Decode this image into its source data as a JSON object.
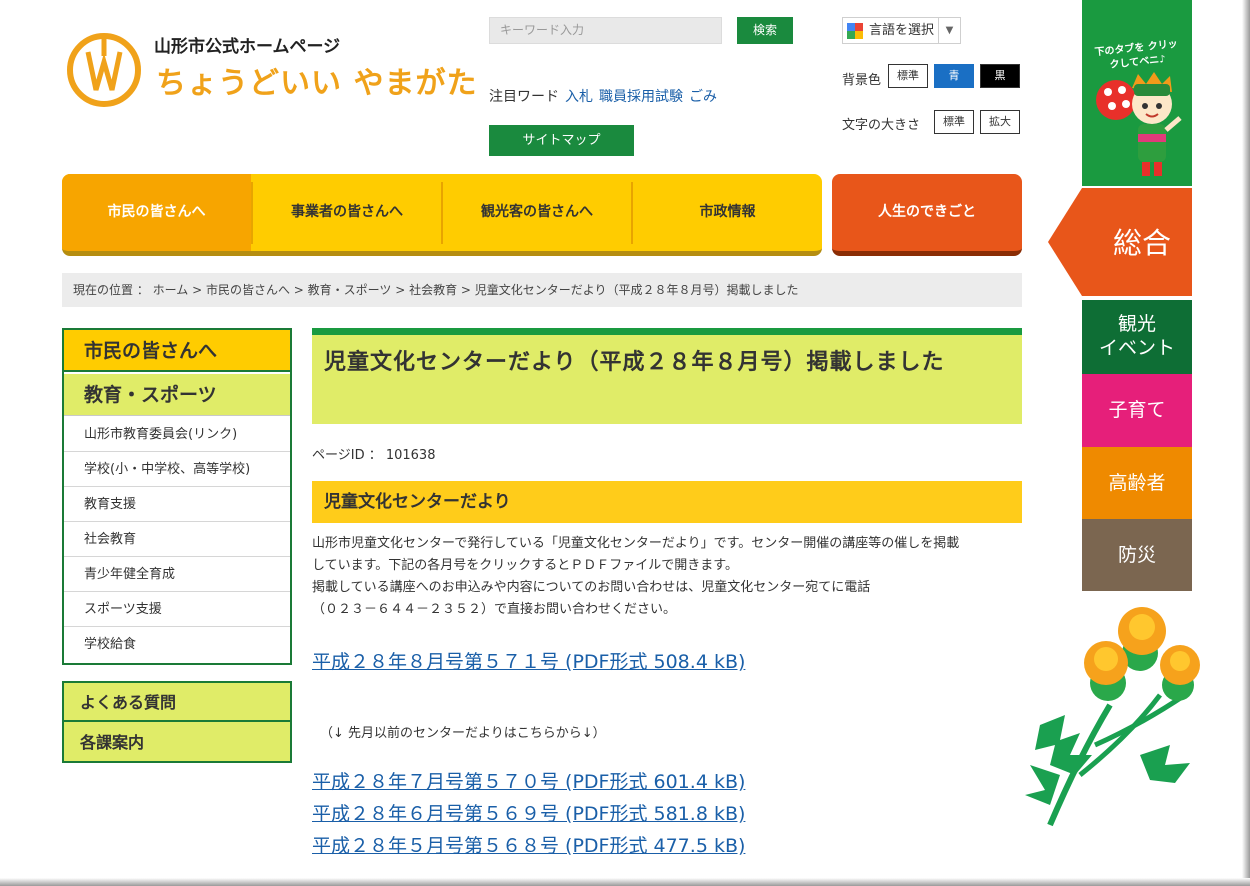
{
  "header": {
    "site_name": "山形市公式ホームページ",
    "site_catch": "ちょうどいい やまがた",
    "search_placeholder": "キーワード入力",
    "search_button": "検索",
    "attention_label": "注目ワード",
    "attention_words": [
      "入札",
      "職員採用試験",
      "ごみ"
    ],
    "sitemap_button": "サイトマップ",
    "translate_label": "言語を選択",
    "translate_arrow": "▼",
    "bg_color_label": "背景色",
    "bg_buttons": [
      "標準",
      "青",
      "黒"
    ],
    "font_size_label": "文字の大きさ",
    "font_buttons": [
      "標準",
      "拡大"
    ]
  },
  "gnav": {
    "items": [
      "市民の皆さんへ",
      "事業者の皆さんへ",
      "観光客の皆さんへ",
      "市政情報"
    ],
    "life_button": "人生のできごと"
  },
  "breadcrumb": "現在の位置 ： ホーム > 市民の皆さんへ > 教育・スポーツ > 社会教育 > 児童文化センターだより（平成２８年８月号）掲載しました",
  "sidebar": {
    "head1": "市民の皆さんへ",
    "head2": "教育・スポーツ",
    "items": [
      "山形市教育委員会(リンク)",
      "学校(小・中学校、高等学校)",
      "教育支援",
      "社会教育",
      "青少年健全育成",
      "スポーツ支援",
      "学校給食"
    ],
    "links": [
      "よくある質問",
      "各課案内"
    ]
  },
  "main": {
    "title": "児童文化センターだより（平成２８年８月号）掲載しました",
    "page_id": "ページID ： 101638",
    "section_title": "児童文化センターだより",
    "body_line1": "山形市児童文化センターで発行している「児童文化センターだより」です。センター開催の講座等の催しを掲載",
    "body_line2": "しています。下記の各月号をクリックするとＰＤＦファイルで開きます。",
    "body_line3": "掲載している講座へのお申込みや内容についてのお問い合わせは、児童文化センター宛てに電話",
    "body_line4": "（０２３－６４４－２３５２）で直接お問い合わせください。",
    "current_link": "平成２８年８月号第５７１号 (PDF形式  508.4 kB)",
    "note": "（↓ 先月以前のセンターだよりはこちらから↓）",
    "past_links": [
      "平成２８年７月号第５７０号 (PDF形式  601.4 kB)",
      "平成２８年６月号第５６９号 (PDF形式  581.8 kB)",
      "平成２８年５月号第５６８号 (PDF形式  477.5 kB)"
    ]
  },
  "right_tabs": {
    "mascot_text": "下のタブを クリックしてベニ♪",
    "sougou": "総合",
    "kankou_line1": "観光",
    "kankou_line2": "イベント",
    "kosodate": "子育て",
    "koureisha": "高齢者",
    "bousai": "防災"
  },
  "colors": {
    "green": "#1a8a3e",
    "yellow": "#ffcc00",
    "orange": "#e8561a",
    "lime": "#e0ec68",
    "link": "#1a5fa8",
    "tab_kankou": "#0e6e35",
    "tab_kosodate": "#e61f7a",
    "tab_koureisha": "#ef8a00",
    "tab_bousai": "#7b6650"
  }
}
